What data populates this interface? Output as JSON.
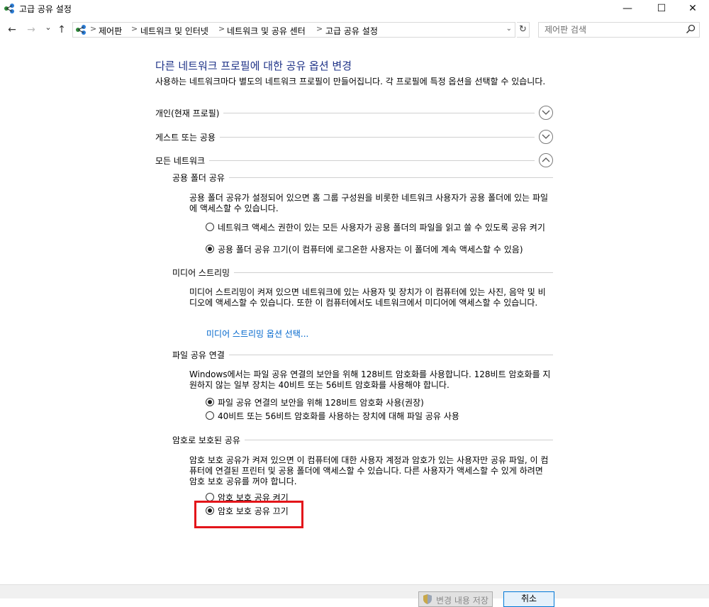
{
  "window": {
    "title": "고급 공유 설정",
    "minimize_glyph": "—",
    "maximize_glyph": "☐",
    "close_glyph": "✕"
  },
  "nav": {
    "back_glyph": "←",
    "forward_glyph": "→",
    "recent_glyph": "⌄",
    "up_glyph": "↑",
    "breadcrumbs": [
      "제어판",
      "네트워크 및 인터넷",
      "네트워크 및 공유 센터",
      "고급 공유 설정"
    ],
    "separator": ">",
    "dropdown_glyph": "⌄",
    "refresh_glyph": "↻"
  },
  "search": {
    "placeholder": "제어판 검색"
  },
  "content": {
    "title": "다른 네트워크 프로필에 대한 공유 옵션 변경",
    "description": "사용하는 네트워크마다 별도의 네트워크 프로필이 만들어집니다. 각 프로필에 특정 옵션을 선택할 수 있습니다.",
    "profiles": [
      {
        "label": "개인(현재 프로필)",
        "expanded": false
      },
      {
        "label": "게스트 또는 공용",
        "expanded": false
      },
      {
        "label": "모든 네트워크",
        "expanded": true
      }
    ],
    "sections": {
      "public_folder": {
        "heading": "공용 폴더 공유",
        "description": "공용 폴더 공유가 설정되어 있으면 홈 그룹 구성원을 비롯한 네트워크 사용자가 공용 폴더에 있는 파일에 액세스할 수 있습니다.",
        "options": [
          {
            "label": "네트워크 액세스 권한이 있는 모든 사용자가 공용 폴더의 파일을 읽고 쓸 수 있도록 공유 켜기",
            "checked": false
          },
          {
            "label": "공용 폴더 공유 끄기(이 컴퓨터에 로그온한 사용자는 이 폴더에 계속 액세스할 수 있음)",
            "checked": true
          }
        ]
      },
      "media_streaming": {
        "heading": "미디어 스트리밍",
        "description": "미디어 스트리밍이 켜져 있으면 네트워크에 있는 사용자 및 장치가 이 컴퓨터에 있는 사진, 음악 및 비디오에 액세스할 수 있습니다. 또한 이 컴퓨터에서도 네트워크에서 미디어에 액세스할 수 있습니다.",
        "link": "미디어 스트리밍 옵션 선택..."
      },
      "file_sharing": {
        "heading": "파일 공유 연결",
        "description": "Windows에서는 파일 공유 연결의 보안을 위해 128비트 암호화를 사용합니다. 128비트 암호화를 지원하지 않는 일부 장치는 40비트 또는 56비트 암호화를 사용해야 합니다.",
        "options": [
          {
            "label": "파일 공유 연결의 보안을 위해 128비트 암호화 사용(권장)",
            "checked": true
          },
          {
            "label": "40비트 또는 56비트 암호화를 사용하는 장치에 대해 파일 공유 사용",
            "checked": false
          }
        ]
      },
      "password_sharing": {
        "heading": "암호로 보호된 공유",
        "description": "암호 보호 공유가 켜져 있으면 이 컴퓨터에 대한 사용자 계정과 암호가 있는 사용자만 공유 파일, 이 컴퓨터에 연결된 프린터 및 공용 폴더에 액세스할 수 있습니다. 다른 사용자가 액세스할 수 있게 하려면 암호 보호 공유를 꺼야 합니다.",
        "options": [
          {
            "label": "암호 보호 공유 켜기",
            "checked": false
          },
          {
            "label": "암호 보호 공유 끄기",
            "checked": true
          }
        ]
      }
    }
  },
  "footer": {
    "save_label": "변경 내용 저장",
    "cancel_label": "취소"
  },
  "colors": {
    "title_blue": "#1e3287",
    "link_blue": "#0066cc",
    "highlight_red": "#e3151a"
  }
}
